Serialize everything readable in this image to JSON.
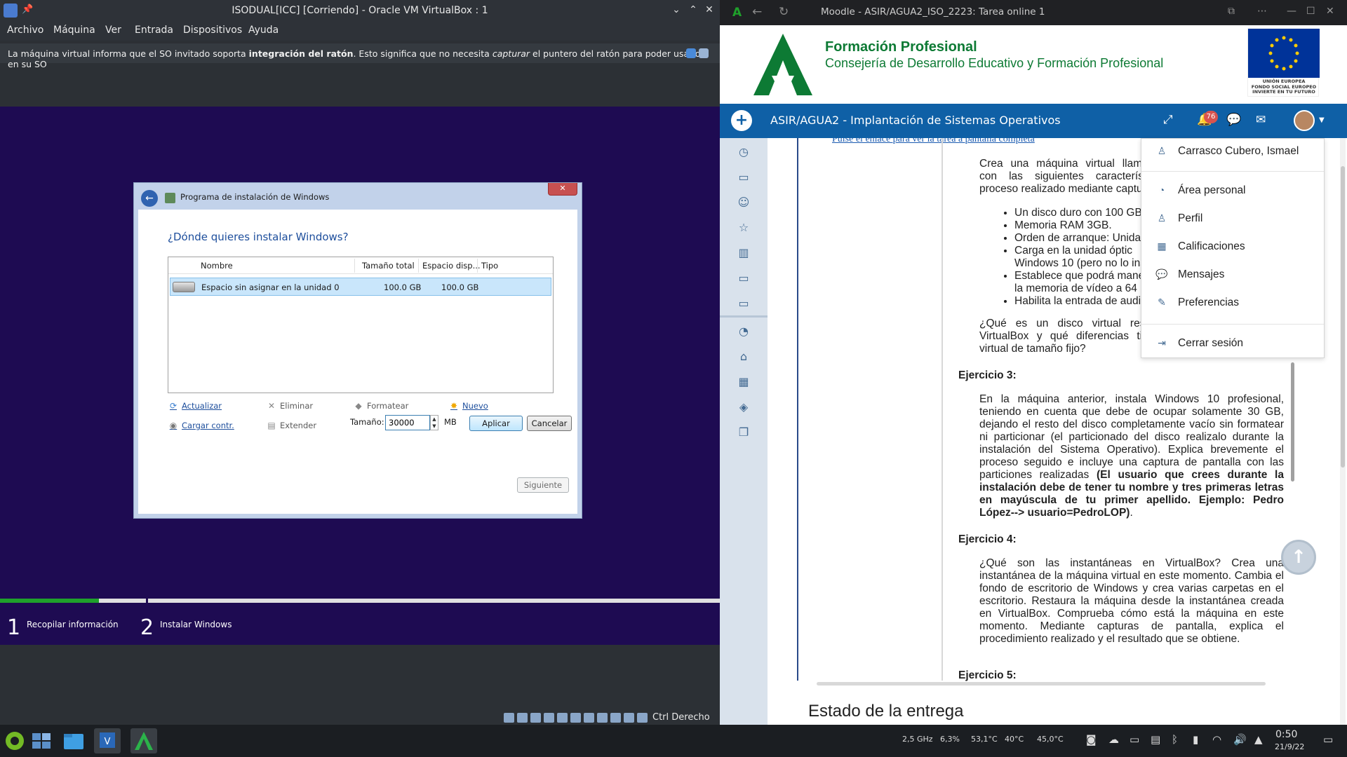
{
  "vbox": {
    "title": "ISODUAL[ICC] [Corriendo] - Oracle VM VirtualBox : 1",
    "menu": [
      "Archivo",
      "Máquina",
      "Ver",
      "Entrada",
      "Dispositivos",
      "Ayuda"
    ],
    "notice_pre": "La máquina virtual informa que el SO invitado soporta ",
    "notice_bold": "integración del ratón",
    "notice_mid": ". Esto significa que no necesita ",
    "notice_ital": "capturar",
    "notice_post": " el puntero del ratón para poder usarlo en su SO",
    "host_key": "Ctrl Derecho"
  },
  "setup": {
    "title": "Programa de instalación de Windows",
    "close": "✕",
    "question": "¿Dónde quieres instalar Windows?",
    "columns": [
      "Nombre",
      "Tamaño total",
      "Espacio disp...",
      "Tipo"
    ],
    "rows": [
      {
        "name": "Espacio sin asignar en la unidad 0",
        "total": "100.0 GB",
        "free": "100.0 GB",
        "type": ""
      }
    ],
    "tools": {
      "refresh": "Actualizar",
      "delete": "Eliminar",
      "format": "Formatear",
      "new": "Nuevo",
      "load": "Cargar contr.",
      "extend": "Extender"
    },
    "size_label": "Tamaño:",
    "size_value": "30000",
    "size_unit": "MB",
    "apply": "Aplicar",
    "cancel": "Cancelar",
    "next": "Siguiente",
    "steps": [
      {
        "num": "1",
        "label": "Recopilar información"
      },
      {
        "num": "2",
        "label": "Instalar Windows"
      }
    ],
    "progress_pct": 68
  },
  "browser": {
    "title": "Moodle - ASIR/AGUA2_ISO_2223: Tarea online 1",
    "brand_line1": "Formación Profesional",
    "brand_line2": "Consejería de Desarrollo Educativo y Formación Profesional",
    "eu_text": [
      "UNIÓN EUROPEA",
      "FONDO SOCIAL EUROPEO",
      "INVIERTE EN TU FUTURO"
    ],
    "course_title": "ASIR/AGUA2 - Implantación de Sistemas Operativos",
    "notifications": "76",
    "toplink": "Pulse el enlace para ver la tarea a pantalla completa",
    "intro": "Crea una máquina virtual llamada con las siguientes característica proceso realizado mediante captura",
    "bullets": [
      "Un disco duro con 100 GB re",
      "Memoria RAM 3GB.",
      "Orden de arranque: Unidad ó",
      "Carga en la unidad óptic Windows 10 (pero no lo insta",
      "Establece que podrá maneja la memoria de vídeo a 64 MB",
      "Habilita la entrada de audio."
    ],
    "question2": "¿Qué es un disco virtual reserv VirtualBox y qué diferencias tiene virtual de tamaño fijo?",
    "ex3_title": "Ejercicio 3:",
    "ex3_text": "En la máquina anterior, instala Windows 10 profesional, teniendo en cuenta que debe de ocupar solamente 30 GB, dejando el resto del disco completamente vacío sin formatear ni particionar (el particionado del disco realizalo durante la instalación del Sistema Operativo). Explica brevemente el proceso seguido e incluye una captura de pantalla con las particiones realizadas ",
    "ex3_bold": "(El usuario que crees durante la instalación debe de tener tu nombre y tres primeras letras en mayúscula de tu primer apellido. Ejemplo: Pedro López--> usuario=PedroLOP)",
    "ex3_end": ".",
    "ex4_title": "Ejercicio 4:",
    "ex4_text": "¿Qué son las instantáneas en VirtualBox? Crea una instantánea de la máquina virtual en este momento. Cambia el fondo de escritorio de Windows y crea varias carpetas en el escritorio. Restaura la máquina desde la instantánea creada en VirtualBox. Comprueba cómo está la máquina en este momento. Mediante capturas de pantalla, explica el procedimiento realizado y el resultado que se obtiene.",
    "ex5_title": "Ejercicio 5:",
    "estado": "Estado de la entrega"
  },
  "user_menu": {
    "items": [
      {
        "icon": "user-icon",
        "label": "Carrasco Cubero, Ismael"
      },
      {
        "icon": "dashboard-icon",
        "label": "Área personal"
      },
      {
        "icon": "profile-icon",
        "label": "Perfil"
      },
      {
        "icon": "grades-icon",
        "label": "Calificaciones"
      },
      {
        "icon": "messages-icon",
        "label": "Mensajes"
      },
      {
        "icon": "wrench-icon",
        "label": "Preferencias"
      },
      {
        "icon": "logout-icon",
        "label": "Cerrar sesión"
      }
    ]
  },
  "taskbar": {
    "cpu_freq": "2,5 GHz",
    "cpu_load": "6,3%",
    "temp1": "53,1°C",
    "temp2": "40°C",
    "temp3": "45,0°C",
    "time": "0:50",
    "date": "21/9/22"
  },
  "colors": {
    "vm_bg": "#1e0b52",
    "moodle_nav": "#0f60a6",
    "brand_green": "#0d7a34",
    "progress_green": "#1fa12b"
  }
}
